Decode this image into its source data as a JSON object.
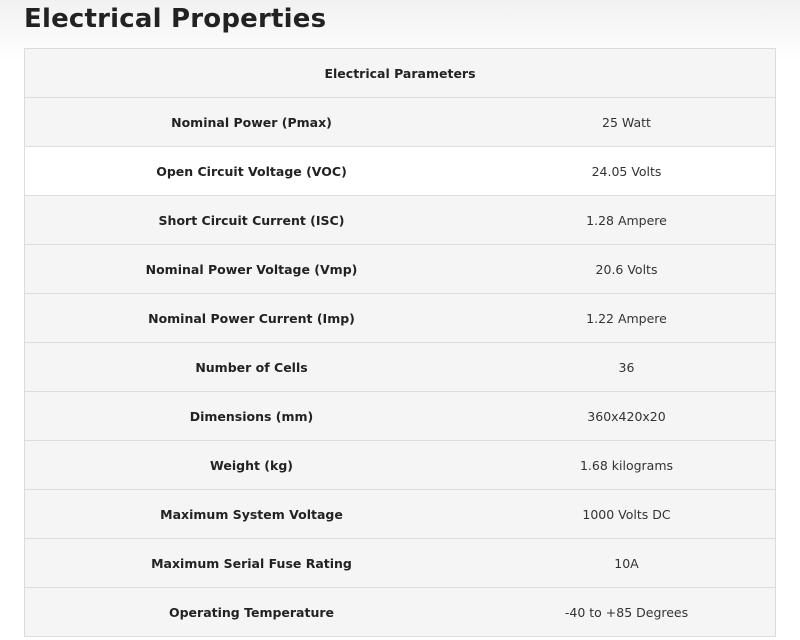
{
  "title": "Electrical Properties",
  "table": {
    "header": "Electrical Parameters",
    "rows": [
      {
        "param": "Nominal Power (Pmax)",
        "value": "25 Watt"
      },
      {
        "param": "Open Circuit Voltage (VOC)",
        "value": "24.05 Volts"
      },
      {
        "param": "Short Circuit Current (ISC)",
        "value": "1.28 Ampere"
      },
      {
        "param": "Nominal Power Voltage (Vmp)",
        "value": "20.6 Volts"
      },
      {
        "param": "Nominal Power Current (Imp)",
        "value": "1.22 Ampere"
      },
      {
        "param": "Number of Cells",
        "value": "36"
      },
      {
        "param": "Dimensions (mm)",
        "value": "360x420x20"
      },
      {
        "param": "Weight (kg)",
        "value": "1.68 kilograms"
      },
      {
        "param": "Maximum System Voltage",
        "value": "1000 Volts DC"
      },
      {
        "param": "Maximum Serial Fuse Rating",
        "value": "10A"
      },
      {
        "param": "Operating Temperature",
        "value": "-40 to +85 Degrees"
      }
    ]
  }
}
